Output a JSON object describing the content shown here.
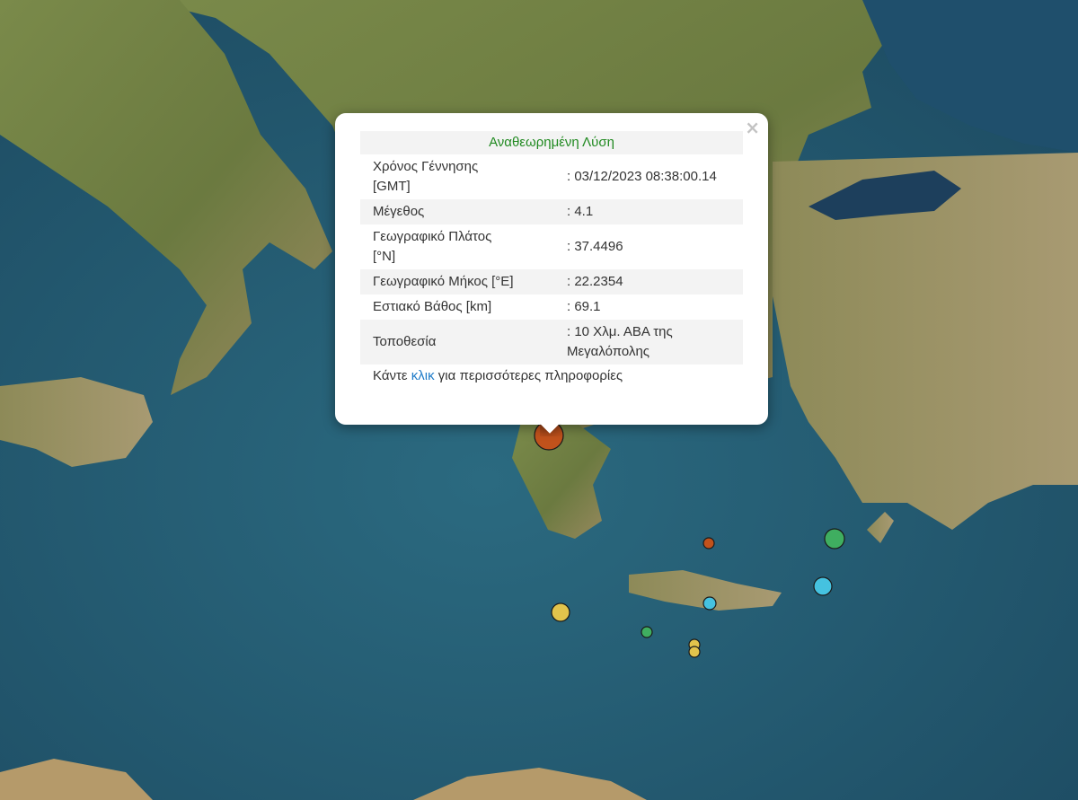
{
  "popup": {
    "title": "Αναθεωρημένη Λύση",
    "close_symbol": "×",
    "rows": [
      {
        "label": "Χρόνος Γέννησης [GMT]",
        "value": ": 03/12/2023 08:38:00.14"
      },
      {
        "label": "Μέγεθος",
        "value": ": 4.1"
      },
      {
        "label": "Γεωγραφικό Πλάτος [°N]",
        "value": ": 37.4496"
      },
      {
        "label": "Γεωγραφικό Μήκος [°E]",
        "value": ": 22.2354"
      },
      {
        "label": "Εστιακό Βάθος [km]",
        "value": ": 69.1"
      },
      {
        "label": "Τοποθεσία",
        "value": ": 10 Χλμ. ΑΒΑ της Μεγαλόπολης"
      }
    ],
    "more_prefix": "Κάντε ",
    "more_link": "κλικ",
    "more_suffix": " για περισσότερες πληροφορίες"
  },
  "markers": [
    {
      "color": "#c1521c"
    },
    {
      "color": "#c1521c"
    },
    {
      "color": "#3fae60"
    },
    {
      "color": "#45c2e0"
    },
    {
      "color": "#45c2e0"
    },
    {
      "color": "#e2c44c"
    },
    {
      "color": "#3fae60"
    },
    {
      "color": "#e2c44c"
    },
    {
      "color": "#e2c44c"
    }
  ],
  "colors": {
    "sea_deep": "#1f4e67",
    "sea_shallow": "#2d6f86",
    "land": "#6f7f45",
    "land_dry": "#9c8c62"
  }
}
